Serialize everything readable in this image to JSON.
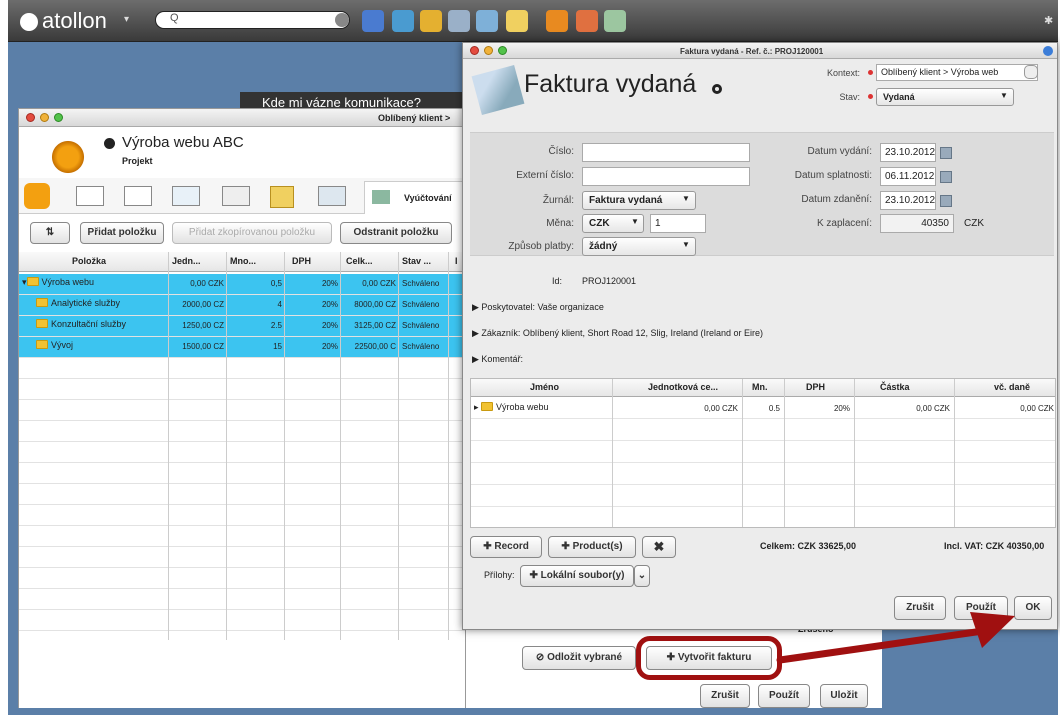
{
  "topbar": {
    "brand": "atollon",
    "search_placeholder": "Q"
  },
  "background_banner": "Kde mi vázne komunikace?",
  "project_window": {
    "title_right": "Oblíbený klient >",
    "project_name": "Výroba webu ABC",
    "project_type": "Projekt",
    "tab_label": "Vyúčtování",
    "buttons": {
      "add_item": "Přidat položku",
      "add_group": "Přidat zkopírovanou položku",
      "remove_item": "Odstranit položku"
    },
    "columns": [
      "Položka",
      "Jedn...",
      "Mno...",
      "DPH",
      "Celk...",
      "Stav ...",
      "I"
    ],
    "rows": [
      {
        "name": "Výroba webu",
        "unit": "0,00 CZK",
        "qty": "0,5",
        "vat": "20%",
        "total": "0,00 CZK",
        "status": "Schváleno"
      },
      {
        "name": "Analytické služby",
        "unit": "2000,00 CZ",
        "qty": "4",
        "vat": "20%",
        "total": "8000,00 CZ",
        "status": "Schváleno"
      },
      {
        "name": "Konzultační služby",
        "unit": "1250,00 CZ",
        "qty": "2.5",
        "vat": "20%",
        "total": "3125,00 CZ",
        "status": "Schváleno"
      },
      {
        "name": "Vývoj",
        "unit": "1500,00 CZ",
        "qty": "15",
        "vat": "20%",
        "total": "22500,00 C",
        "status": "Schváleno"
      }
    ],
    "bottom_buttons": {
      "cancel_selected": "Odložit vybrané",
      "create_invoice": "Vytvořit fakturu",
      "cancel": "Zrušit",
      "apply": "Použít",
      "save": "Uložit"
    },
    "status_peek": "Zrušeno"
  },
  "invoice_window": {
    "title": "Faktura vydaná - Ref. č.: PROJ120001",
    "heading": "Faktura vydaná",
    "context_label": "Kontext:",
    "context_value": "Oblíbený klient > Výroba web",
    "state_label": "Stav:",
    "state_value": "Vydaná",
    "form": {
      "number_label": "Číslo:",
      "number_value": "",
      "ext_number_label": "Externí číslo:",
      "ext_number_value": "",
      "journal_label": "Žurnál:",
      "journal_value": "Faktura vydaná",
      "currency_label": "Měna:",
      "currency_value": "CZK",
      "rate_value": "1",
      "payment_label": "Způsob platby:",
      "payment_value": "žádný",
      "issue_label": "Datum vydání:",
      "issue_value": "23.10.2012",
      "due_label": "Datum splatnosti:",
      "due_value": "06.11.2012",
      "tax_label": "Datum zdanění:",
      "tax_value": "23.10.2012",
      "topay_label": "K zaplacení:",
      "topay_value": "40350",
      "topay_currency": "CZK"
    },
    "id_label": "Id:",
    "id_value": "PROJ120001",
    "provider": "Poskytovatel: Vaše organizace",
    "customer": "Zákazník: Oblíbený klient, Short Road 12, Slig, Ireland (Ireland or Eire)",
    "comment": "Komentář:",
    "columns": [
      "Jméno",
      "Jednotková ce...",
      "Mn.",
      "DPH",
      "Částka",
      "vč. daně"
    ],
    "rows": [
      {
        "name": "Výroba webu",
        "unit": "0,00 CZK",
        "qty": "0.5",
        "vat": "20%",
        "amount": "0,00 CZK",
        "gross": "0,00 CZK"
      }
    ],
    "buttons": {
      "record": "Record",
      "products": "Product(s)",
      "local_files": "Lokální soubor(y)",
      "cancel": "Zrušit",
      "apply": "Použít",
      "ok": "OK"
    },
    "total": "Celkem: CZK 33625,00",
    "total_vat": "Incl. VAT: CZK 40350,00",
    "attachments_label": "Přílohy:"
  },
  "colors": {
    "selection": "#3cc4f0",
    "highlight": "#a01010",
    "desktop": "#5b7fa8"
  }
}
